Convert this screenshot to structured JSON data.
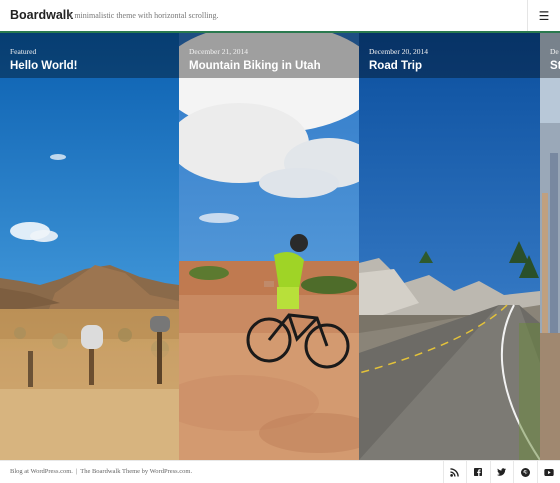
{
  "header": {
    "site_title": "Boardwalk",
    "tagline": "A minimalistic theme with horizontal scrolling.",
    "menu_icon": "hamburger-menu-icon"
  },
  "posts": [
    {
      "meta": "Featured",
      "title": "Hello World!"
    },
    {
      "meta": "December 21, 2014",
      "title": "Mountain Biking in Utah"
    },
    {
      "meta": "December 20, 2014",
      "title": "Road Trip"
    },
    {
      "meta": "De",
      "title": "St"
    }
  ],
  "footer": {
    "credit_1": "Blog at WordPress.com.",
    "separator": "|",
    "credit_2": "The Boardwalk Theme by WordPress.com.",
    "social_icons": [
      "rss-icon",
      "facebook-icon",
      "twitter-icon",
      "pinterest-icon",
      "youtube-icon"
    ]
  }
}
